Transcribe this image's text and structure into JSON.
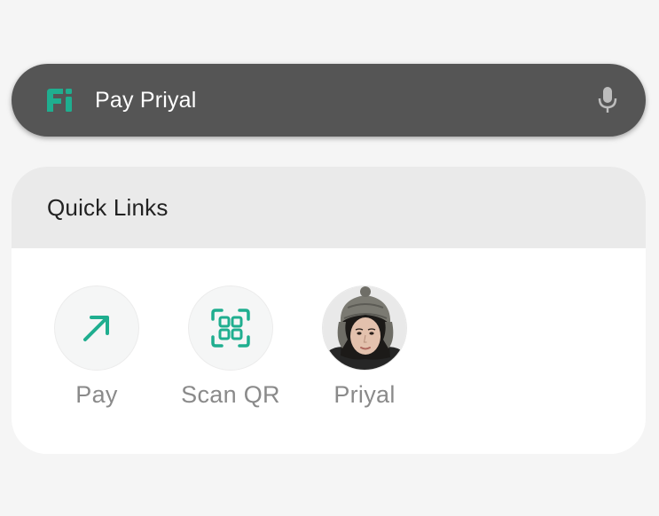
{
  "search": {
    "text": "Pay Priyal",
    "logo_icon": "fi-logo-icon",
    "mic_icon": "microphone-icon"
  },
  "quick_links": {
    "title": "Quick Links",
    "items": [
      {
        "label": "Pay",
        "icon": "arrow-up-right-icon"
      },
      {
        "label": "Scan QR",
        "icon": "qr-code-icon"
      },
      {
        "label": "Priyal",
        "icon": "avatar"
      }
    ]
  },
  "colors": {
    "accent": "#1fae8f",
    "search_bg": "#555555",
    "header_bg": "#eaeaea",
    "label_gray": "#8a8a8a"
  }
}
